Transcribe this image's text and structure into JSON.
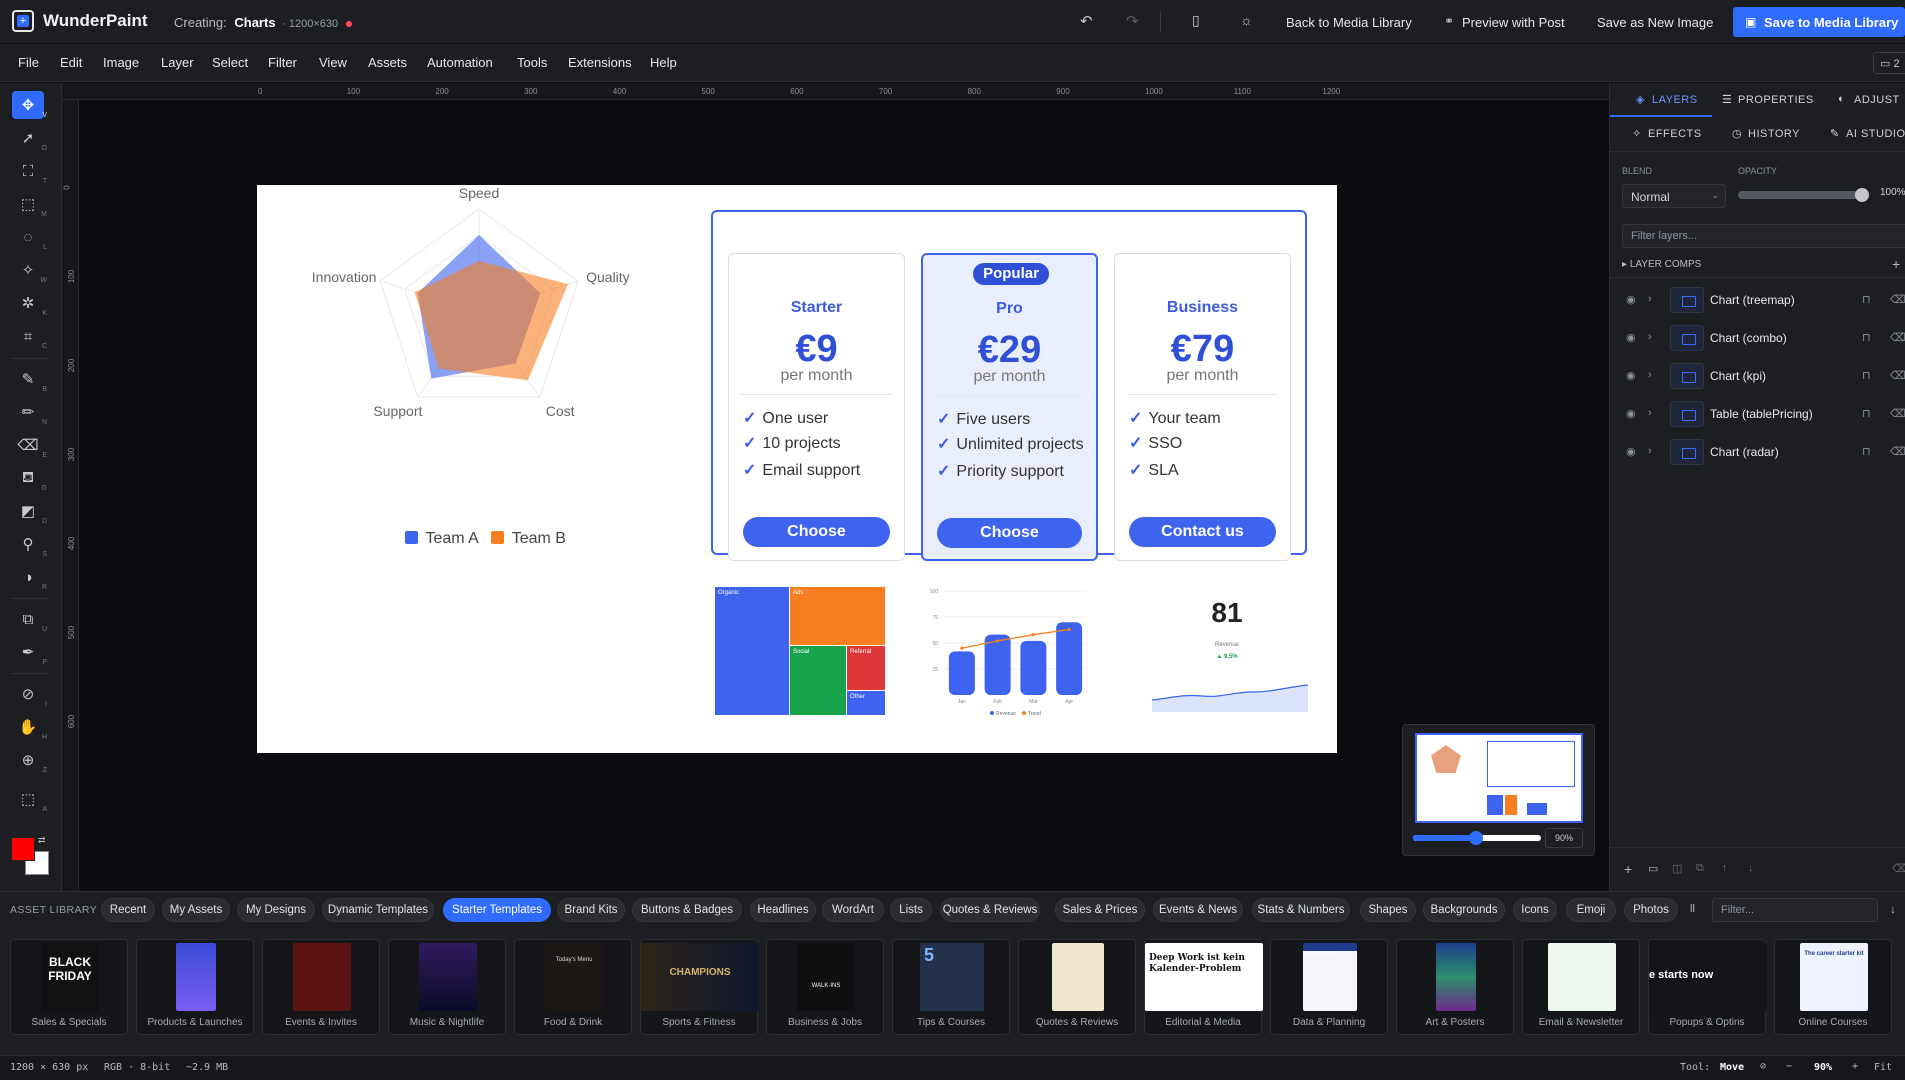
{
  "app": {
    "name": "WunderPaint",
    "creating_label": "Creating:",
    "creating_title": "Charts",
    "creating_size": "· 1200×630"
  },
  "topbar": {
    "back_label": "Back to Media Library",
    "preview_label": "Preview with Post",
    "save_new_label": "Save as New Image",
    "save_library_label": "Save to Media Library",
    "badge": "2"
  },
  "menu": [
    "File",
    "Edit",
    "Image",
    "Layer",
    "Select",
    "Filter",
    "View",
    "Assets",
    "Automation",
    "Tools",
    "Extensions",
    "Help"
  ],
  "tools": [
    {
      "icon": "move-icon",
      "key": "V"
    },
    {
      "icon": "pointer-icon",
      "key": "O"
    },
    {
      "icon": "transform-icon",
      "key": "T"
    },
    {
      "icon": "marquee-icon",
      "key": "M"
    },
    {
      "icon": "lasso-icon",
      "key": "L"
    },
    {
      "icon": "magic-wand-icon",
      "key": "W"
    },
    {
      "icon": "smart-select-icon",
      "key": "K"
    },
    {
      "icon": "crop-icon",
      "key": "C"
    },
    {
      "icon": "brush-icon",
      "key": "B"
    },
    {
      "icon": "pencil-icon",
      "key": "N"
    },
    {
      "icon": "eraser-icon",
      "key": "E"
    },
    {
      "icon": "fill-icon",
      "key": "G"
    },
    {
      "icon": "gradient-icon",
      "key": "D"
    },
    {
      "icon": "stamp-icon",
      "key": "S"
    },
    {
      "icon": "dodge-icon",
      "key": "R"
    },
    {
      "icon": "shape-icon",
      "key": "U"
    },
    {
      "icon": "pen-icon",
      "key": "P"
    },
    {
      "icon": "eyedropper-icon",
      "key": "I"
    },
    {
      "icon": "hand-icon",
      "key": "H"
    },
    {
      "icon": "zoom-icon",
      "key": "Z"
    },
    {
      "icon": "ai-icon",
      "key": "A"
    }
  ],
  "colors": {
    "foreground": "#ff0000",
    "background": "#ffffff",
    "accent": "#2f6bff",
    "teamA": "#3d63ef",
    "teamB": "#f77f22"
  },
  "ruler": {
    "top": [
      "0",
      "100",
      "200",
      "300",
      "400",
      "500",
      "600",
      "700",
      "800",
      "900",
      "1000",
      "1100",
      "1200"
    ],
    "left": [
      "0",
      "100",
      "200",
      "300",
      "400",
      "500",
      "600"
    ]
  },
  "right_panel": {
    "tabs_row1": [
      "LAYERS",
      "PROPERTIES",
      "ADJUST"
    ],
    "tabs_row2": [
      "EFFECTS",
      "HISTORY",
      "AI STUDIO"
    ],
    "blend_label": "BLEND",
    "blend_value": "Normal",
    "opacity_label": "OPACITY",
    "opacity_value": "100%",
    "opacity_level": 1.0,
    "filter_placeholder": "Filter layers...",
    "layer_comps": "LAYER COMPS",
    "layers": [
      "Chart (treemap)",
      "Chart (combo)",
      "Chart (kpi)",
      "Table (tablePricing)",
      "Chart (radar)"
    ]
  },
  "navigator": {
    "zoom": "90%",
    "zoom_level": 0.5
  },
  "asset_library": {
    "label": "ASSET LIBRARY",
    "chips": [
      "Recent",
      "My Assets",
      "My Designs",
      "Dynamic Templates",
      "Starter Templates",
      "Brand Kits",
      "Buttons & Badges",
      "Headlines",
      "WordArt",
      "Lists",
      "Quotes & Reviews",
      "Sales & Prices",
      "Events & News",
      "Stats & Numbers",
      "Shapes",
      "Backgrounds",
      "Icons",
      "Emoji",
      "Photos"
    ],
    "active_chip": "Starter Templates",
    "filter_placeholder": "Filter...",
    "thumbs": [
      {
        "caption": "Sales & Specials",
        "text": "BLACK FRIDAY"
      },
      {
        "caption": "Products & Launches",
        "text": ""
      },
      {
        "caption": "Events & Invites",
        "text": ""
      },
      {
        "caption": "Music & Nightlife",
        "text": ""
      },
      {
        "caption": "Food & Drink",
        "text": "Today's Menu"
      },
      {
        "caption": "Sports & Fitness",
        "text": "CHAMPIONS"
      },
      {
        "caption": "Business & Jobs",
        "text": "WALK-INS"
      },
      {
        "caption": "Tips & Courses",
        "text": "5"
      },
      {
        "caption": "Quotes & Reviews",
        "text": ""
      },
      {
        "caption": "Editorial & Media",
        "text": "Deep Work ist kein Kalender-Problem"
      },
      {
        "caption": "Data & Planning",
        "text": "A record year"
      },
      {
        "caption": "Art & Posters",
        "text": ""
      },
      {
        "caption": "Email & Newsletter",
        "text": ""
      },
      {
        "caption": "Popups & Optins",
        "text": "e starts now"
      },
      {
        "caption": "Online Courses",
        "text": "The career starter kit"
      }
    ]
  },
  "status": {
    "dims": "1200 × 630 px",
    "mode": "RGB · 8-bit",
    "size": "~2.9 MB",
    "tool_label": "Tool:",
    "tool_value": "Move",
    "zoom": "90%",
    "fit": "Fit"
  },
  "artboard": {
    "radar": {
      "axes": [
        "Speed",
        "Quality",
        "Cost",
        "Support",
        "Innovation"
      ],
      "legend": [
        "Team A",
        "Team B"
      ]
    },
    "pricing": [
      {
        "tier": "Starter",
        "price": "€9",
        "per": "per month",
        "features": [
          "One user",
          "10 projects",
          "Email support"
        ],
        "button": "Choose"
      },
      {
        "tier": "Pro",
        "badge": "Popular",
        "price": "€29",
        "per": "per month",
        "features": [
          "Five users",
          "Unlimited projects",
          "Priority support"
        ],
        "button": "Choose"
      },
      {
        "tier": "Business",
        "price": "€79",
        "per": "per month",
        "features": [
          "Your team",
          "SSO",
          "SLA"
        ],
        "button": "Contact us"
      }
    ],
    "treemap": [
      "Organic",
      "Ads",
      "Social",
      "Referral",
      "Other"
    ],
    "kpi": {
      "value": "81",
      "label": "Revenue",
      "delta": "▲ 9.5%"
    },
    "combo": {
      "legend": [
        "Revenue",
        "Trend"
      ]
    }
  },
  "chart_data": [
    {
      "type": "radar",
      "categories": [
        "Speed",
        "Quality",
        "Cost",
        "Support",
        "Innovation"
      ],
      "series": [
        {
          "name": "Team A",
          "values": [
            0.75,
            0.62,
            0.6,
            0.78,
            0.62
          ]
        },
        {
          "name": "Team B",
          "values": [
            0.5,
            0.9,
            0.8,
            0.66,
            0.65
          ]
        }
      ]
    },
    {
      "type": "bar",
      "categories": [
        "Jan",
        "Feb",
        "Mar",
        "Apr"
      ],
      "series": [
        {
          "name": "Revenue",
          "values": [
            42,
            58,
            52,
            70
          ]
        },
        {
          "name": "Trend",
          "values": [
            45,
            52,
            58,
            63
          ]
        }
      ],
      "ylim": [
        0,
        100
      ],
      "yticks": [
        "25",
        "50",
        "75",
        "100"
      ]
    },
    {
      "type": "heatmap",
      "categories": [
        "Organic",
        "Ads",
        "Social",
        "Referral",
        "Other"
      ]
    }
  ]
}
